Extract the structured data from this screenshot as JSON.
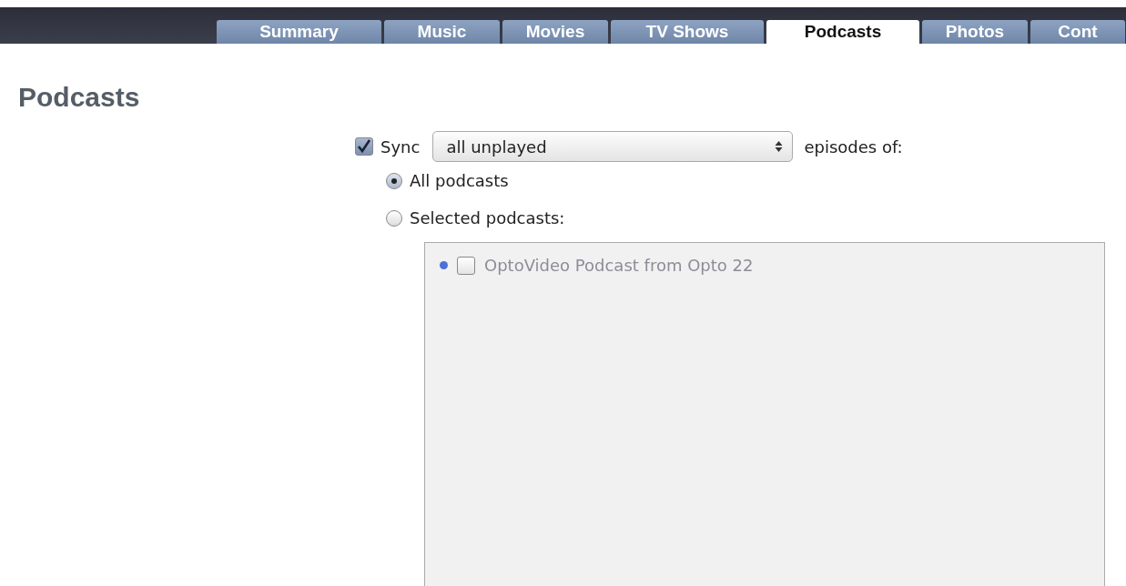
{
  "tabs": [
    {
      "label": "Summary",
      "selected": false
    },
    {
      "label": "Music",
      "selected": false
    },
    {
      "label": "Movies",
      "selected": false
    },
    {
      "label": "TV Shows",
      "selected": false
    },
    {
      "label": "Podcasts",
      "selected": true
    },
    {
      "label": "Photos",
      "selected": false
    },
    {
      "label": "Cont",
      "selected": false
    }
  ],
  "heading": "Podcasts",
  "sync": {
    "checked": true,
    "label": "Sync",
    "select_value": "all unplayed",
    "suffix": "episodes of:"
  },
  "scope": [
    {
      "label": "All podcasts",
      "selected": true
    },
    {
      "label": "Selected podcasts:",
      "selected": false
    }
  ],
  "podcast_list": {
    "disabled": true,
    "items": [
      {
        "title": "OptoVideo Podcast from Opto 22",
        "checked": false,
        "unplayed": true
      }
    ]
  }
}
